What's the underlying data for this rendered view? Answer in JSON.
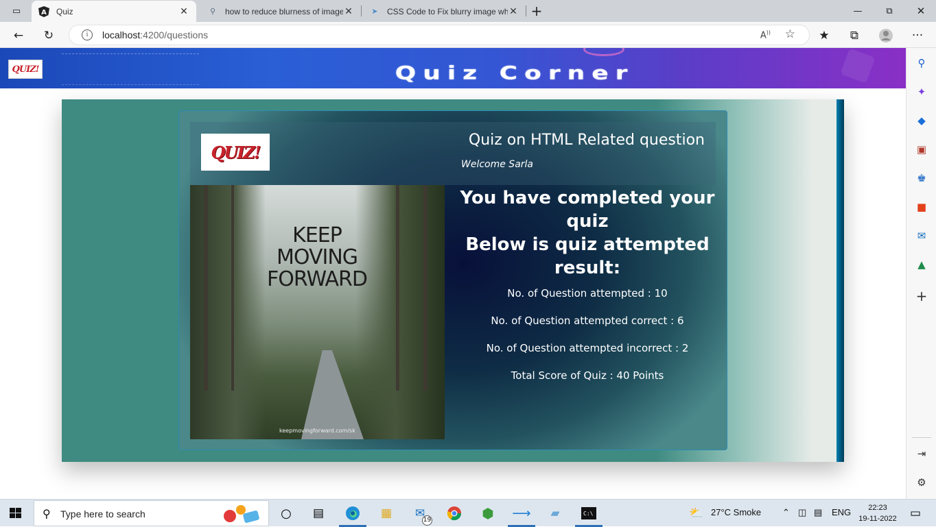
{
  "browser": {
    "tabs": [
      {
        "title": "Quiz",
        "favicon": "angular-icon",
        "active": true
      },
      {
        "title": "how to reduce blurness of image",
        "favicon": "search-icon",
        "active": false
      },
      {
        "title": "CSS Code to Fix blurry image wh",
        "favicon": "code-bird-icon",
        "active": false
      }
    ],
    "url_host": "localhost",
    "url_path": ":4200/questions",
    "read_aloud": "Aᴾ"
  },
  "banner": {
    "logo_text": "QUIZ!",
    "title": "Quiz Corner"
  },
  "card": {
    "logo_text": "QUIZ!",
    "title": "Quiz on HTML Related question",
    "welcome": "Welcome Sarla",
    "poster_text": [
      "KEEP",
      "MOVING",
      "FORWARD"
    ],
    "poster_credit": "keepmovingforward.com/sk"
  },
  "result": {
    "heading_line1": "You have completed your quiz",
    "heading_line2": "Below is quiz attempted result:",
    "attempted": "No. of Question attempted : 10",
    "correct": "No. of Question attempted correct : 6",
    "incorrect": "No. of Question attempted incorrect : 2",
    "score": "Total Score of Quiz : 40 Points"
  },
  "taskbar": {
    "search_placeholder": "Type here to search",
    "mail_badge": "19",
    "weather": "27°C  Smoke",
    "language": "ENG",
    "time": "22:23",
    "date": "19-11-2022"
  }
}
